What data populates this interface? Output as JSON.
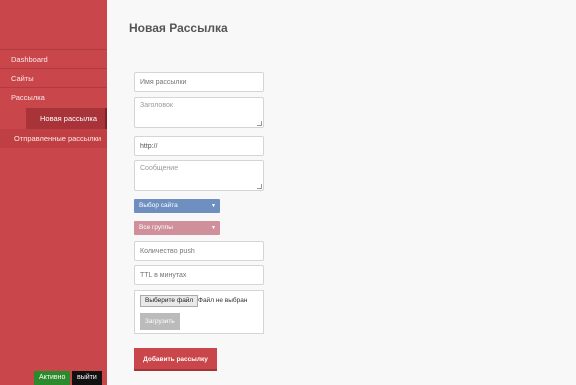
{
  "sidebar": {
    "items": [
      {
        "label": "Dashboard"
      },
      {
        "label": "Сайты"
      },
      {
        "label": "Рассылка"
      },
      {
        "label": "Новая рассылка"
      },
      {
        "label": "Отправленные рассылки"
      }
    ],
    "active_button": "Активно",
    "logout_button": "выйти"
  },
  "main": {
    "title": "Новая Рассылка",
    "fields": {
      "name_placeholder": "Имя рассылки",
      "header_placeholder": "Заголовок",
      "url_value": "http://",
      "message_placeholder": "Сообщение",
      "count_placeholder": "Количество push",
      "ttl_placeholder": "TTL в минутах"
    },
    "selects": {
      "site": "Выбор сайта",
      "groups": "Все группы"
    },
    "file": {
      "choose_label": "Выберите файл",
      "status": "Файл не выбран",
      "upload_label": "Загрузить"
    },
    "submit_label": "Добавить рассылку"
  },
  "colors": {
    "sidebar": "#c9464a",
    "select_site": "#6f8fc0",
    "select_groups": "#cf8f9b",
    "active": "#2b8a2b"
  }
}
